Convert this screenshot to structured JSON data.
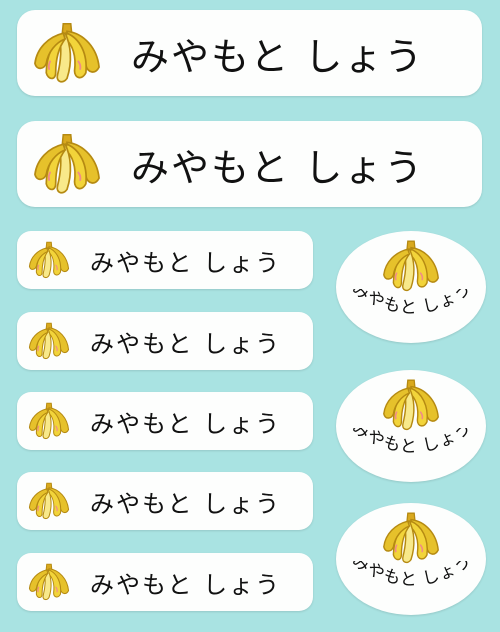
{
  "sheet": {
    "background": "#a9e3e2",
    "label_color": "#fdfefd",
    "icon": "banana-bunch-icon",
    "banana_colors": {
      "peel": "#f2d43a",
      "light": "#f8e98a",
      "outline": "#b58a12",
      "blush": "#f08a8a"
    },
    "name_text": "みやもと しょう"
  },
  "large_labels": [
    {
      "name": "みやもと しょう"
    },
    {
      "name": "みやもと しょう"
    }
  ],
  "small_labels": [
    {
      "name": "みやもと しょう"
    },
    {
      "name": "みやもと しょう"
    },
    {
      "name": "みやもと しょう"
    },
    {
      "name": "みやもと しょう"
    },
    {
      "name": "みやもと しょう"
    }
  ],
  "oval_labels": [
    {
      "name": "みやもと しょう"
    },
    {
      "name": "みやもと しょう"
    },
    {
      "name": "みやもと しょう"
    }
  ]
}
